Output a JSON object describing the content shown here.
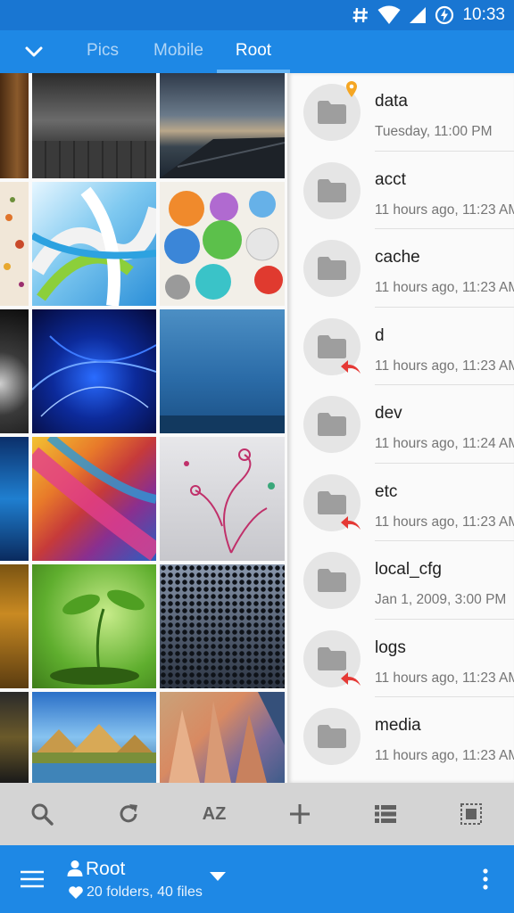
{
  "status_bar": {
    "time": "10:33",
    "icons": [
      "hash-icon",
      "wifi-icon",
      "signal-icon",
      "battery-charging-icon"
    ]
  },
  "tabs": {
    "items": [
      {
        "label": "Pics",
        "active": false
      },
      {
        "label": "Mobile",
        "active": false
      },
      {
        "label": "Root",
        "active": true
      }
    ]
  },
  "gallery": {
    "thumbnails": [
      "wood-texture",
      "dark-metal-wall",
      "pier-sunset",
      "autumn-leaves",
      "3d-ribbons",
      "smiling-gears",
      "dark-gradient",
      "blue-abstract-swirl",
      "underwater-blue",
      "blue-wave",
      "rainbow-feathers",
      "floral-swirls",
      "autumn-forest",
      "green-sprout",
      "metal-mesh",
      "night-lights",
      "pyramids-landscape",
      "cubist-painting"
    ]
  },
  "files": [
    {
      "name": "data",
      "meta": "Tuesday, 11:00 PM",
      "badge": "pin"
    },
    {
      "name": "acct",
      "meta": "11 hours ago, 11:23 AM",
      "badge": ""
    },
    {
      "name": "cache",
      "meta": "11 hours ago, 11:23 AM",
      "badge": ""
    },
    {
      "name": "d",
      "meta": "11 hours ago, 11:23 AM",
      "badge": "link"
    },
    {
      "name": "dev",
      "meta": "11 hours ago, 11:24 AM",
      "badge": ""
    },
    {
      "name": "etc",
      "meta": "11 hours ago, 11:23 AM",
      "badge": "link"
    },
    {
      "name": "local_cfg",
      "meta": "Jan 1, 2009, 3:00 PM",
      "badge": ""
    },
    {
      "name": "logs",
      "meta": "11 hours ago, 11:23 AM",
      "badge": "link"
    },
    {
      "name": "media",
      "meta": "11 hours ago, 11:23 AM",
      "badge": ""
    }
  ],
  "toolbar": {
    "sort_label": "AZ",
    "icons": [
      "search-icon",
      "refresh-icon",
      "sort-az-icon",
      "add-icon",
      "view-list-icon",
      "select-all-icon"
    ]
  },
  "appbar": {
    "title": "Root",
    "subtitle": "20 folders, 40 files"
  },
  "colors": {
    "status_bar": "#1976d2",
    "primary": "#1e88e5",
    "tab_indicator": "#64b5f6",
    "toolbar_bg": "#d4d4d4",
    "folder_circle": "#e5e5e5",
    "folder_icon": "#9e9e9e",
    "pin_badge": "#f5a623",
    "link_badge": "#e53935"
  }
}
